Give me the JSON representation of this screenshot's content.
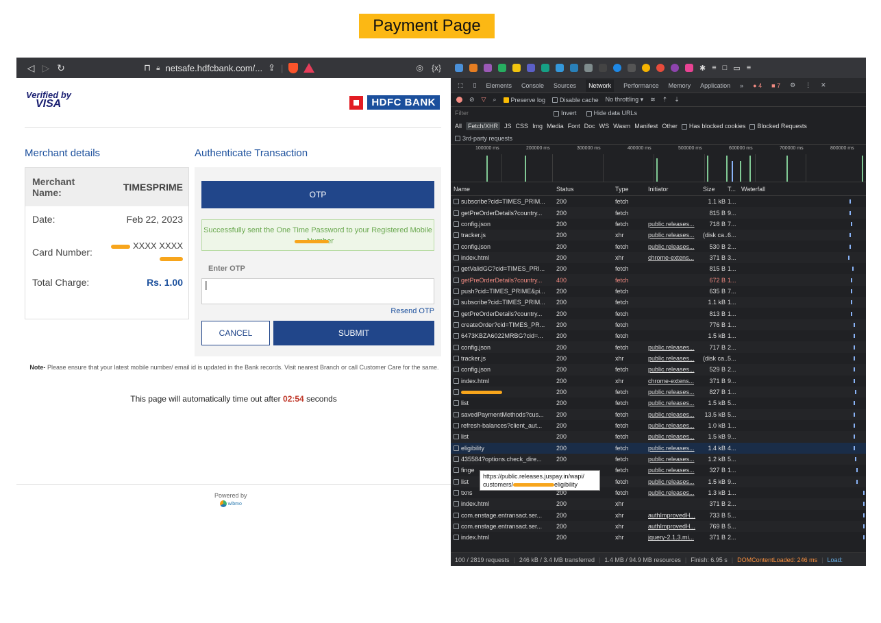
{
  "page_title": "Payment Page",
  "browser": {
    "url": "netsafe.hdfcbank.com/..."
  },
  "logos": {
    "visa_top": "Verified by",
    "visa_bottom": "VISA",
    "hdfc": "HDFC BANK"
  },
  "merchant": {
    "section_title": "Merchant details",
    "name_label": "Merchant Name:",
    "name_value": "TIMESPRIME",
    "date_label": "Date:",
    "date_value": "Feb 22, 2023",
    "card_label": "Card Number:",
    "card_value": "XXXX XXXX",
    "total_label": "Total Charge:",
    "total_value": "Rs. 1.00"
  },
  "auth": {
    "section_title": "Authenticate Transaction",
    "otp_header": "OTP",
    "success_msg": "Successfully sent the One Time Password to your Registered Mobile Number",
    "enter_otp_label": "Enter OTP",
    "resend_label": "Resend OTP",
    "cancel_label": "CANCEL",
    "submit_label": "SUBMIT"
  },
  "note": {
    "prefix": "Note-",
    "text": "Please ensure that your latest mobile number/ email id is updated in the Bank records. Visit nearest Branch or call Customer Care for the same."
  },
  "timeout": {
    "before": "This page will automatically time out after",
    "timer": "02:54",
    "after": "seconds"
  },
  "powered": {
    "label": "Powered by",
    "brand": "wibmo"
  },
  "devtools": {
    "tabs": [
      "Elements",
      "Console",
      "Sources",
      "Network",
      "Performance",
      "Memory",
      "Application",
      "»"
    ],
    "active_tab": "Network",
    "error_count": "4",
    "warn_count": "7",
    "controls": {
      "preserve_log": "Preserve log",
      "disable_cache": "Disable cache",
      "throttling": "No throttling"
    },
    "filter_placeholder": "Filter",
    "invert": "Invert",
    "hide_data_urls": "Hide data URLs",
    "types": [
      "All",
      "Fetch/XHR",
      "JS",
      "CSS",
      "Img",
      "Media",
      "Font",
      "Doc",
      "WS",
      "Wasm",
      "Manifest",
      "Other"
    ],
    "has_blocked_cookies": "Has blocked cookies",
    "blocked_requests": "Blocked Requests",
    "third_party": "3rd-party requests",
    "timeline_labels": [
      "100000 ms",
      "200000 ms",
      "300000 ms",
      "400000 ms",
      "500000 ms",
      "600000 ms",
      "700000 ms",
      "800000 ms"
    ],
    "columns": [
      "Name",
      "Status",
      "Type",
      "Initiator",
      "Size",
      "T...",
      "Waterfall"
    ],
    "rows": [
      {
        "name": "subscribe?cid=TIMES_PRIM...",
        "status": "200",
        "type": "fetch",
        "initiator": "",
        "size": "1.1 kB",
        "time": "1..."
      },
      {
        "name": "getPreOrderDetails?country...",
        "status": "200",
        "type": "fetch",
        "initiator": "",
        "size": "815 B",
        "time": "9..."
      },
      {
        "name": "config.json",
        "status": "200",
        "type": "fetch",
        "initiator": "public.releases...",
        "size": "718 B",
        "time": "7..."
      },
      {
        "name": "tracker.js",
        "status": "200",
        "type": "xhr",
        "initiator": "public.releases...",
        "size": "(disk ca...",
        "time": "6..."
      },
      {
        "name": "config.json",
        "status": "200",
        "type": "fetch",
        "initiator": "public.releases...",
        "size": "530 B",
        "time": "2..."
      },
      {
        "name": "index.html",
        "status": "200",
        "type": "xhr",
        "initiator": "chrome-extens...",
        "size": "371 B",
        "time": "3..."
      },
      {
        "name": "getValidGC?cid=TIMES_PRI...",
        "status": "200",
        "type": "fetch",
        "initiator": "",
        "size": "815 B",
        "time": "1..."
      },
      {
        "name": "getPreOrderDetails?country...",
        "status": "400",
        "type": "fetch",
        "initiator": "",
        "size": "672 B",
        "time": "1...",
        "error": true
      },
      {
        "name": "push?cid=TIMES_PRIME&pi...",
        "status": "200",
        "type": "fetch",
        "initiator": "",
        "size": "635 B",
        "time": "7..."
      },
      {
        "name": "subscribe?cid=TIMES_PRIM...",
        "status": "200",
        "type": "fetch",
        "initiator": "",
        "size": "1.1 kB",
        "time": "1..."
      },
      {
        "name": "getPreOrderDetails?country...",
        "status": "200",
        "type": "fetch",
        "initiator": "",
        "size": "813 B",
        "time": "1..."
      },
      {
        "name": "createOrder?cid=TIMES_PR...",
        "status": "200",
        "type": "fetch",
        "initiator": "",
        "size": "776 B",
        "time": "1..."
      },
      {
        "name": "6473KBZA6022MRBG?cid=...",
        "status": "200",
        "type": "fetch",
        "initiator": "",
        "size": "1.5 kB",
        "time": "1..."
      },
      {
        "name": "config.json",
        "status": "200",
        "type": "fetch",
        "initiator": "public.releases...",
        "size": "717 B",
        "time": "2..."
      },
      {
        "name": "tracker.js",
        "status": "200",
        "type": "xhr",
        "initiator": "public.releases...",
        "size": "(disk ca...",
        "time": "5..."
      },
      {
        "name": "config.json",
        "status": "200",
        "type": "fetch",
        "initiator": "public.releases...",
        "size": "529 B",
        "time": "2..."
      },
      {
        "name": "index.html",
        "status": "200",
        "type": "xhr",
        "initiator": "chrome-extens...",
        "size": "371 B",
        "time": "9..."
      },
      {
        "name": "",
        "status": "200",
        "type": "fetch",
        "initiator": "public.releases...",
        "size": "827 B",
        "time": "1...",
        "redacted": true
      },
      {
        "name": "list",
        "status": "200",
        "type": "fetch",
        "initiator": "public.releases...",
        "size": "1.5 kB",
        "time": "5..."
      },
      {
        "name": "savedPaymentMethods?cus...",
        "status": "200",
        "type": "fetch",
        "initiator": "public.releases...",
        "size": "13.5 kB",
        "time": "5..."
      },
      {
        "name": "refresh-balances?client_aut...",
        "status": "200",
        "type": "fetch",
        "initiator": "public.releases...",
        "size": "1.0 kB",
        "time": "1..."
      },
      {
        "name": "list",
        "status": "200",
        "type": "fetch",
        "initiator": "public.releases...",
        "size": "1.5 kB",
        "time": "9..."
      },
      {
        "name": "eligibility",
        "status": "200",
        "type": "fetch",
        "initiator": "public.releases...",
        "size": "1.4 kB",
        "time": "4...",
        "selected": true
      },
      {
        "name": "435584?options.check_dire...",
        "status": "200",
        "type": "fetch",
        "initiator": "public.releases...",
        "size": "1.2 kB",
        "time": "5..."
      },
      {
        "name": "finge",
        "status": "",
        "type": "fetch",
        "initiator": "public.releases...",
        "size": "327 B",
        "time": "1..."
      },
      {
        "name": "list",
        "status": "",
        "type": "fetch",
        "initiator": "public.releases...",
        "size": "1.5 kB",
        "time": "9..."
      },
      {
        "name": "txns",
        "status": "200",
        "type": "fetch",
        "initiator": "public.releases...",
        "size": "1.3 kB",
        "time": "1..."
      },
      {
        "name": "index.html",
        "status": "200",
        "type": "xhr",
        "initiator": "",
        "size": "371 B",
        "time": "2..."
      },
      {
        "name": "com.enstage.entransact.ser...",
        "status": "200",
        "type": "xhr",
        "initiator": "authImprovedH...",
        "size": "733 B",
        "time": "5..."
      },
      {
        "name": "com.enstage.entransact.ser...",
        "status": "200",
        "type": "xhr",
        "initiator": "authImprovedH...",
        "size": "769 B",
        "time": "5..."
      },
      {
        "name": "index.html",
        "status": "200",
        "type": "xhr",
        "initiator": "jquery-2.1.3.mi...",
        "size": "371 B",
        "time": "2..."
      }
    ],
    "tooltip_line1": "https://public.releases.juspay.in/wapi/",
    "tooltip_line2_prefix": "customers/",
    "tooltip_line2_suffix": "eligibility",
    "status_bar": {
      "requests": "100 / 2819 requests",
      "transferred": "246 kB / 3.4 MB transferred",
      "resources": "1.4 MB / 94.9 MB resources",
      "finish": "Finish: 6.95 s",
      "dcl": "DOMContentLoaded: 246 ms",
      "load": "Load:"
    }
  },
  "colors": {
    "accent_yellow": "#fcb814",
    "hdfc_blue": "#21468a",
    "error_red": "#f28b82"
  }
}
